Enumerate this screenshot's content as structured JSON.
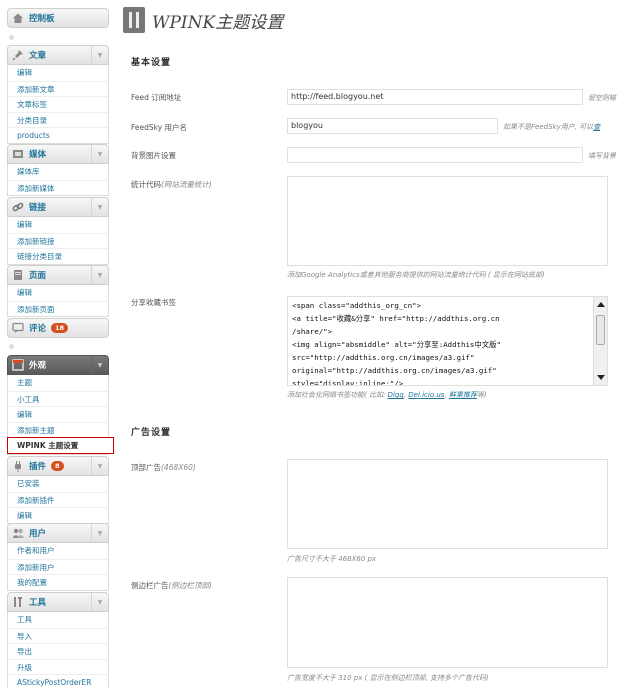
{
  "sidebar": {
    "dashboard": "控制板",
    "posts": {
      "title": "文章",
      "items": [
        "编辑",
        "添加新文章",
        "文章标签",
        "分类目录",
        "products"
      ]
    },
    "media": {
      "title": "媒体",
      "items": [
        "媒体库",
        "添加新媒体"
      ]
    },
    "links": {
      "title": "链接",
      "items": [
        "编辑",
        "添加新链接",
        "链接分类目录"
      ]
    },
    "pages": {
      "title": "页面",
      "items": [
        "编辑",
        "添加新页面"
      ]
    },
    "comments": {
      "title": "评论",
      "badge": "18"
    },
    "appearance": {
      "title": "外观",
      "items": [
        "主题",
        "小工具",
        "编辑",
        "添加新主题",
        "WPINK 主题设置"
      ]
    },
    "plugins": {
      "title": "插件",
      "badge": "8",
      "items": [
        "已安装",
        "添加新插件",
        "编辑"
      ]
    },
    "users": {
      "title": "用户",
      "items": [
        "作者和用户",
        "添加新用户",
        "我的配置"
      ]
    },
    "tools": {
      "title": "工具",
      "items": [
        "工具",
        "导入",
        "导出",
        "升级",
        "AStickyPostOrderER"
      ]
    }
  },
  "page": {
    "title": "WPINK主题设置",
    "basic_heading": "基本设置",
    "feed_label": "Feed 订阅地址",
    "feed_value": "http://feed.blogyou.net",
    "feed_help": "留空则输",
    "feedsky_label": "FeedSky 用户名",
    "feedsky_value": "blogyou",
    "feedsky_help_prefix": "如果不是FeedSky用户, 可以",
    "feedsky_help_link": "查",
    "bg_label": "背景图片设置",
    "bg_help": "填写背景",
    "stats_label": "统计代码",
    "stats_label_note": "(网站流量统计)",
    "stats_help": "添加Google Analytics或者其他服务商提供的网站流量统计代码 ( 显示在网站底部)",
    "share_label": "分享收藏书签",
    "share_code": "<span class=\"addthis_org_cn\">\n<a title=\"收藏&分享\" href=\"http://addthis.org.cn\n/share/\">\n<img align=\"absmiddle\" alt=\"分享至:Addthis中文版\"\nsrc=\"http://addthis.org.cn/images/a3.gif\"\noriginal=\"http://addthis.org.cn/images/a3.gif\"\nstyle=\"display:inline;\"/>",
    "share_help_prefix": "添加社会化网络书签功能( 比如: ",
    "share_help_links": [
      "Digg",
      "Del.icio.us",
      "鲜果推荐"
    ],
    "share_help_suffix": "等)",
    "ads_heading": "广告设置",
    "top_ad_label": "顶部广告",
    "top_ad_note": "(468X60)",
    "top_ad_help": "广告尺寸不大于 468X60 px",
    "side_ad_label": "侧边栏广告",
    "side_ad_note": "(侧边栏顶部)",
    "side_ad_help": "广告宽度不大于 310 px ( 显示在侧边栏顶部, 支持多个广告代码)"
  },
  "colors": {
    "link": "#21759b",
    "badge": "#d54e21",
    "highlight": "#cc0000"
  }
}
